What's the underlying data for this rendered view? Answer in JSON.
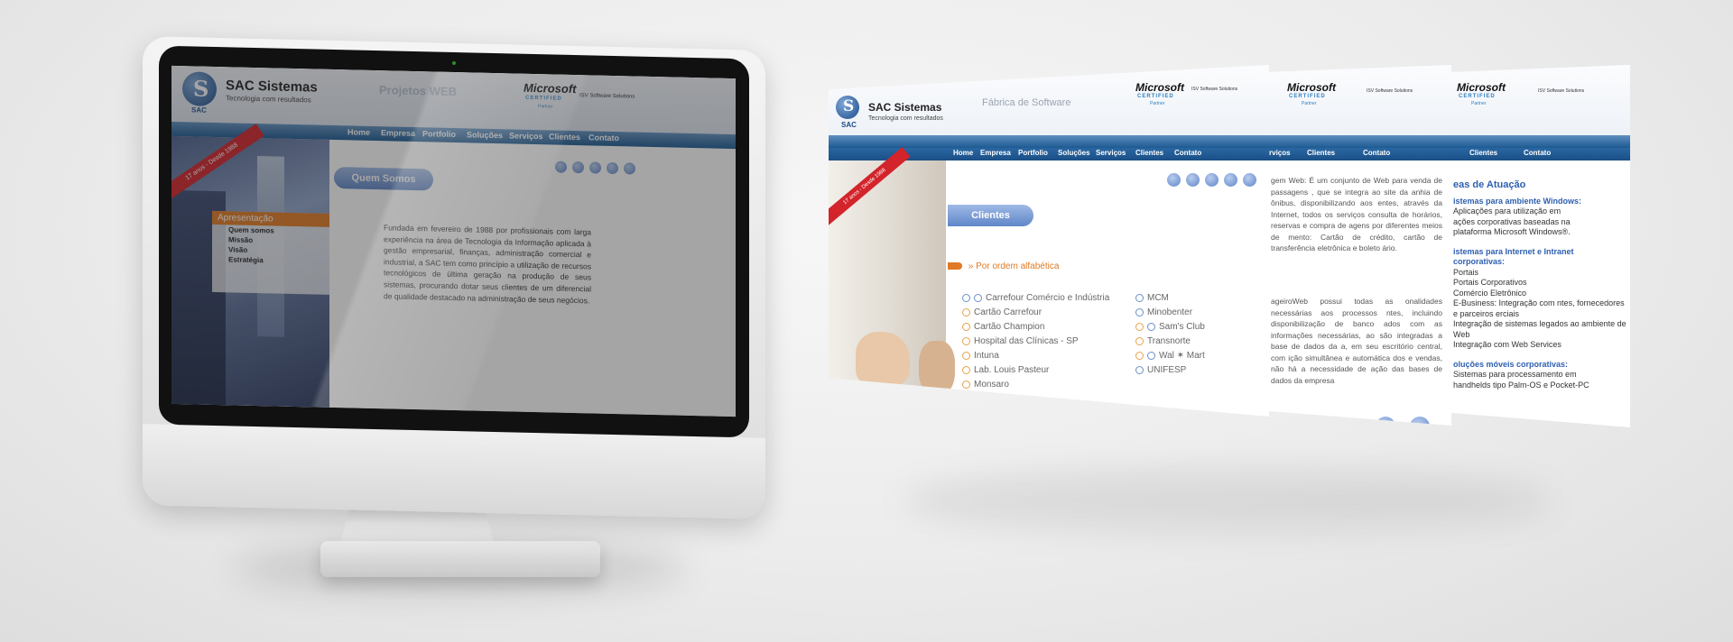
{
  "monitor_site": {
    "brand": "SAC Sistemas",
    "tagline": "Tecnologia com resultados",
    "logo_letter": "S",
    "logo_small": "SAC",
    "header_title": "Projetos WEB",
    "ms_logo": "Microsoft",
    "ms_certified": "CERTIFIED",
    "ms_partner": "Partner",
    "isv": "ISV Software Solutions",
    "nav": [
      "Home",
      "Empresa",
      "Portfolio",
      "Soluções",
      "Serviços",
      "Clientes",
      "Contato"
    ],
    "ribbon": "17 anos - Desde 1988",
    "section_pill": "Quem Somos",
    "menu_header": "Apresentação",
    "menu_items": [
      "Quem somos",
      "Missão",
      "Visão",
      "Estratégia"
    ],
    "body_text": "Fundada em fevereiro de 1988 por profissionais com larga experiência na área de Tecnologia da Informação aplicada à gestão empresarial, finanças, administração comercial e industrial, a SAC tem como princípio a utilização de recursos tecnológicos de última geração na produção de seus sistemas, procurando dotar seus clientes de um diferencial de qualidade destacado na administração de seus negócios."
  },
  "panel1": {
    "brand": "SAC Sistemas",
    "tagline": "Tecnologia com resultados",
    "logo_letter": "S",
    "logo_small": "SAC",
    "header_title": "Fábrica de Software",
    "ms_logo": "Microsoft",
    "ms_certified": "CERTIFIED",
    "ms_partner": "Partner",
    "isv": "ISV Software Solutions",
    "nav": [
      "Home",
      "Empresa",
      "Portfolio",
      "Soluções",
      "Serviços",
      "Clientes",
      "Contato"
    ],
    "ribbon": "17 anos - Desde 1988",
    "section_pill": "Clientes",
    "sort_label": "» Por ordem alfabética",
    "clients_left": [
      "Carrefour Comércio e Indústria",
      "Cartão Carrefour",
      "Cartão Champion",
      "Hospital das Clínicas - SP",
      "Intuna",
      "Lab. Louis Pasteur",
      "Monsaro"
    ],
    "clients_right": [
      "MCM",
      "Minobenter",
      "Sam's Club",
      "Transnorte",
      "Wal ✶ Mart",
      "UNIFESP"
    ]
  },
  "panel2": {
    "ms_logo": "Microsoft",
    "ms_certified": "CERTIFIED",
    "ms_partner": "Partner",
    "isv": "ISV Software Solutions",
    "nav": [
      "rviços",
      "Clientes",
      "Contato"
    ],
    "para1": "gem Web: É um conjunto de Web para venda de passagens , que se integra ao site da anhia de ônibus, disponibilizando aos entes, através da Internet, todos os serviços consulta de horários, reservas e compra de agens por diferentes meios de mento: Cartão de crédito, cartão de transferência eletrônica e boleto ário.",
    "para2": "ageiroWeb possui todas as onalidades necessárias aos processos ntes, incluindo disponibilização de banco ados com as informações necessárias, ao são integradas a base de dados da a, em seu escritório central, com ição simultânea e automática dos e vendas, não há a necessidade de ação das bases de dados da empresa"
  },
  "panel3": {
    "ms_logo": "Microsoft",
    "ms_certified": "CERTIFIED",
    "ms_partner": "Partner",
    "isv": "ISV Software Solutions",
    "nav": [
      "Clientes",
      "Contato"
    ],
    "heading": "eas de Atuação",
    "sub1": "istemas para ambiente Windows:",
    "list1": [
      "Aplicações para utilização em",
      "ações corporativas baseadas na",
      "plataforma Microsoft Windows®."
    ],
    "sub2": "istemas para Internet e Intranet corporativas:",
    "list2": [
      "Portais",
      "Portais Corporativos",
      "Comércio Eletrônico",
      "E-Business: Integração com ntes, fornecedores e parceiros erciais",
      "Integração de sistemas legados ao ambiente de Web",
      "Integração com Web Services"
    ],
    "sub3": "oluções móveis corporativas:",
    "list3": [
      "Sistemas para processamento em",
      "handhelds tipo Palm-OS e Pocket-PC"
    ]
  },
  "colors": {
    "nav_blue": "#1d5a92",
    "pill_blue": "#6f92cf",
    "menu_orange": "#e07a24",
    "ribbon_red": "#d3242b",
    "link_orange": "#e07a24"
  }
}
